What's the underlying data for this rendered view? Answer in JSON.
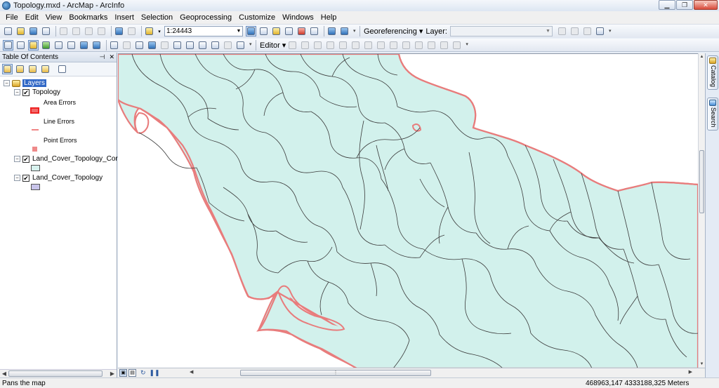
{
  "window": {
    "title": "Topology.mxd - ArcMap - ArcInfo",
    "controls": {
      "minimize": "▁",
      "maximize": "❐",
      "close": "✕"
    }
  },
  "menu": [
    "File",
    "Edit",
    "View",
    "Bookmarks",
    "Insert",
    "Selection",
    "Geoprocessing",
    "Customize",
    "Windows",
    "Help"
  ],
  "toolbar": {
    "scale": "1:24443",
    "georeferencing_label": "Georeferencing ▾",
    "layer_label": "Layer:",
    "layer_value": "",
    "editor_label": "Editor ▾"
  },
  "toc": {
    "title": "Table Of Contents",
    "header_controls": [
      "⊣",
      "✕"
    ],
    "root": {
      "label": "Layers",
      "expanded": true
    },
    "layers": [
      {
        "label": "Topology",
        "checked": true,
        "expanded": true,
        "legend": [
          {
            "label": "Area Errors",
            "symbol": "area",
            "color": "#f26a6a"
          },
          {
            "label": "Line Errors",
            "symbol": "line",
            "color": "#f08585"
          },
          {
            "label": "Point Errors",
            "symbol": "point",
            "color": "#ef8a8a"
          }
        ]
      },
      {
        "label": "Land_Cover_Topology_Corre",
        "checked": true,
        "expanded": true,
        "swatch": "#d7f2ee"
      },
      {
        "label": "Land_Cover_Topology",
        "checked": true,
        "expanded": true,
        "swatch": "#c8c4ea"
      }
    ]
  },
  "right_dock": {
    "tabs": [
      "Catalog",
      "Search"
    ]
  },
  "map": {
    "fill_color": "#d2f1ec",
    "boundary_color": "#e87c7c",
    "line_color": "#3a3a3a"
  },
  "status": {
    "message": "Pans the map",
    "coordinates": "468963,147  4333188,325 Meters"
  }
}
